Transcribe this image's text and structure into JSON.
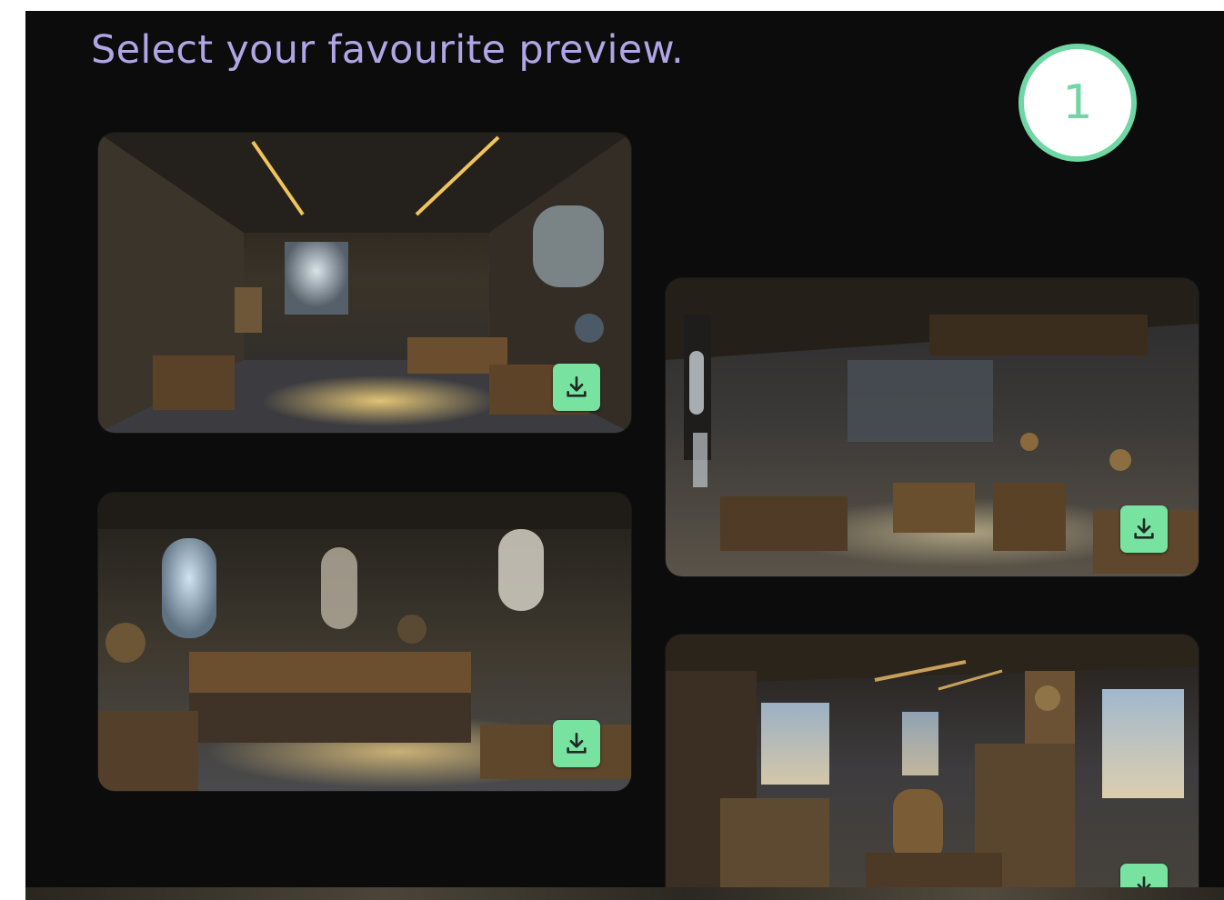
{
  "page": {
    "title": "Select your favourite preview.",
    "step_number": "1"
  },
  "colors": {
    "title": "#b0a6e6",
    "badge": "#6fd7a3",
    "download_button": "#78e3a1",
    "background": "#0c0c0c"
  },
  "previews": [
    {
      "name": "preview-1",
      "download_icon": "download-icon"
    },
    {
      "name": "preview-2",
      "download_icon": "download-icon"
    },
    {
      "name": "preview-3",
      "download_icon": "download-icon"
    },
    {
      "name": "preview-4",
      "download_icon": "download-icon"
    }
  ]
}
